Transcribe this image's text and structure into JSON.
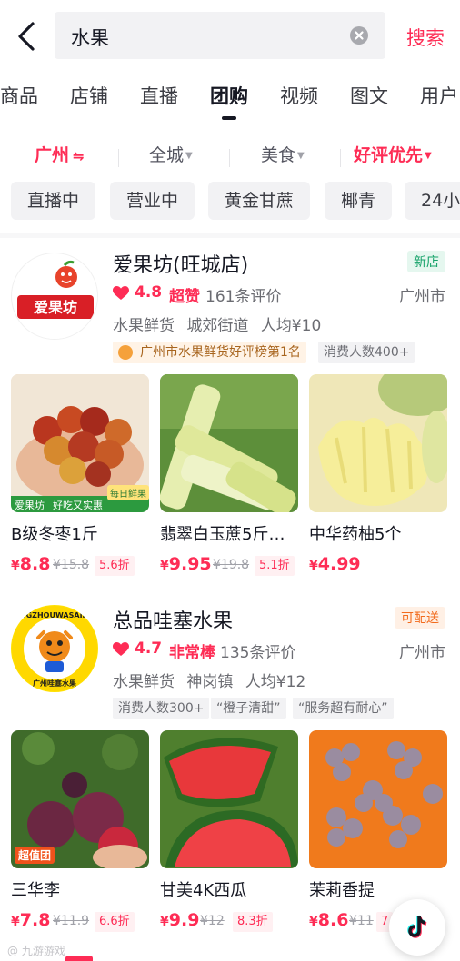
{
  "search": {
    "query": "水果",
    "submit_label": "搜索"
  },
  "tabs": [
    {
      "label": "商品"
    },
    {
      "label": "店铺"
    },
    {
      "label": "直播"
    },
    {
      "label": "团购",
      "active": true
    },
    {
      "label": "视频"
    },
    {
      "label": "图文"
    },
    {
      "label": "用户"
    }
  ],
  "filters": {
    "location": "广州",
    "location_icon": "swap-arrows-icon",
    "area": "全城",
    "category": "美食",
    "sort": "好评优先"
  },
  "chips": [
    "直播中",
    "营业中",
    "黄金甘蔗",
    "椰青",
    "24小"
  ],
  "stores": [
    {
      "name": "爱果坊(旺城店)",
      "badge": "新店",
      "score": "4.8",
      "score_tag": "超赞",
      "reviews": "161条评价",
      "city": "广州市",
      "category": "水果鲜货",
      "district": "城郊街道",
      "avg_price": "人均¥10",
      "rank_tag": "广州市水果鲜货好评榜第1名",
      "tags": [
        "消费人数400+"
      ],
      "logo_text": "爱果坊",
      "products": [
        {
          "name": "B级冬枣1斤",
          "price": "8.8",
          "original": "¥15.8",
          "discount": "5.6折",
          "overlay_left": "爱果坊",
          "overlay_mid": "好吃又实惠",
          "overlay_right": "每日鲜果"
        },
        {
          "name": "翡翠白玉蔗5斤…",
          "price": "9.95",
          "original": "¥19.8",
          "discount": "5.1折"
        },
        {
          "name": "中华药柚5个",
          "price": "4.99",
          "original": "",
          "discount": ""
        }
      ]
    },
    {
      "name": "总品哇塞水果",
      "badge": "可配送",
      "score": "4.7",
      "score_tag": "非常棒",
      "reviews": "135条评价",
      "city": "广州市",
      "category": "水果鲜货",
      "district": "神岗镇",
      "avg_price": "人均¥12",
      "tags": [
        "消费人数300+",
        "“橙子清甜”",
        "“服务超有耐心”"
      ],
      "logo_text_ring": "GUANGZHOUWASAIFRUIT",
      "logo_text_bottom": "广州哇塞水果",
      "products": [
        {
          "name": "三华李",
          "price": "7.8",
          "original": "¥11.9",
          "discount": "6.6折",
          "overlay_left": "超值团"
        },
        {
          "name": "甘美4K西瓜",
          "price": "9.9",
          "original": "¥12",
          "discount": "8.3折"
        },
        {
          "name": "茉莉香提",
          "price": "8.6",
          "original": "¥11",
          "discount": "7"
        }
      ]
    }
  ],
  "fab_icon": "tiktok-icon",
  "watermark": "@ 九游游戏"
}
